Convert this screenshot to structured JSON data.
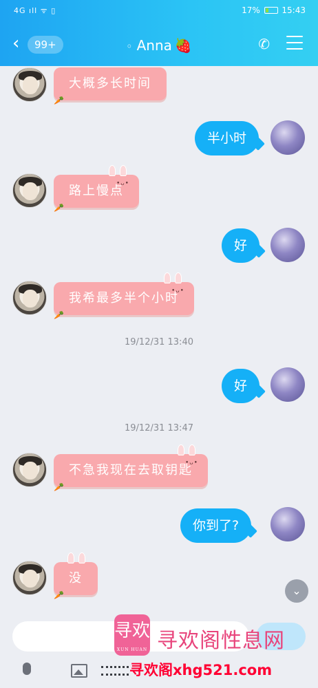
{
  "status_bar": {
    "signal": "4G ıll ᯤ ▯",
    "battery_percent": "17%",
    "time": "15:43"
  },
  "header": {
    "back_icon": "chevron-left-icon",
    "unread_count": "99+",
    "title": "Anna",
    "title_emoji": "🍓",
    "ear_icon": "ear-icon",
    "call_icon": "phone-icon",
    "menu_icon": "menu-icon"
  },
  "messages": [
    {
      "side": "left",
      "text": "大概多长时间",
      "style": "pink-bunny"
    },
    {
      "side": "right",
      "text": "半小时",
      "style": "blue"
    },
    {
      "side": "left",
      "text": "路上慢点",
      "style": "pink-bunny"
    },
    {
      "side": "right",
      "text": "好",
      "style": "blue"
    },
    {
      "side": "left",
      "text": "我希最多半个小时",
      "style": "pink-bunny"
    },
    {
      "type": "timestamp",
      "text": "19/12/31 13:40"
    },
    {
      "side": "right",
      "text": "好",
      "style": "blue"
    },
    {
      "type": "timestamp",
      "text": "19/12/31 13:47"
    },
    {
      "side": "left",
      "text": "不急我现在去取钥匙",
      "style": "pink-bunny"
    },
    {
      "side": "right",
      "text": "你到了?",
      "style": "blue"
    },
    {
      "side": "left",
      "text": "没",
      "style": "pink-bunny"
    }
  ],
  "bunny_eyes": "•ᴗ•",
  "carrot": "🥕",
  "scroll_down_icon": "chevron-down-icon",
  "input": {
    "placeholder": "",
    "send_label": ""
  },
  "toolbar": [
    "microphone-icon",
    "image-icon",
    "film-icon"
  ],
  "watermark": {
    "logo_text": "寻欢",
    "logo_sub": "XUN HUAN",
    "title": "寻欢阁性息网",
    "url": "寻欢阁xhg521.com"
  }
}
